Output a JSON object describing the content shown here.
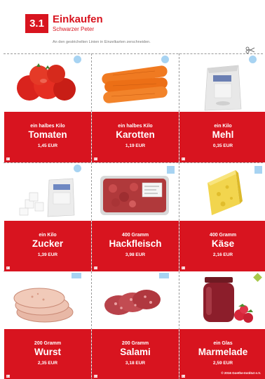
{
  "header": {
    "badge": "3.1",
    "title": "Einkaufen",
    "subtitle": "Schwarzer Peter",
    "instruction": "An den gestrichelten Linien in Einzelkarten zerschneiden."
  },
  "cards": [
    {
      "qty": "ein halbes Kilo",
      "name": "Tomaten",
      "price": "1,45 EUR",
      "num": "3.1",
      "marker": "circle"
    },
    {
      "qty": "ein halbes Kilo",
      "name": "Karotten",
      "price": "1,19 EUR",
      "num": "3.1",
      "marker": "circle"
    },
    {
      "qty": "ein Kilo",
      "name": "Mehl",
      "price": "0,35 EUR",
      "num": "3.1",
      "marker": "circle"
    },
    {
      "qty": "ein Kilo",
      "name": "Zucker",
      "price": "1,39 EUR",
      "num": "3.1",
      "marker": "circle"
    },
    {
      "qty": "400 Gramm",
      "name": "Hackfleisch",
      "price": "3,98 EUR",
      "num": "3.1",
      "marker": "square"
    },
    {
      "qty": "400 Gramm",
      "name": "Käse",
      "price": "2,16 EUR",
      "num": "3.1",
      "marker": "square"
    },
    {
      "qty": "200 Gramm",
      "name": "Wurst",
      "price": "2,35 EUR",
      "num": "3.1",
      "marker": "rect"
    },
    {
      "qty": "200 Gramm",
      "name": "Salami",
      "price": "3,18 EUR",
      "num": "3.1",
      "marker": "rect"
    },
    {
      "qty": "ein Glas",
      "name": "Marmelade",
      "price": "2,59 EUR",
      "num": "3.1",
      "marker": "diamond"
    }
  ],
  "footer": {
    "copyright": "© 2016 Goethe-Institut e.V."
  },
  "colors": {
    "brand_red": "#d8141f",
    "marker_blue": "#a7d3f2",
    "marker_green": "#a7c84b"
  }
}
